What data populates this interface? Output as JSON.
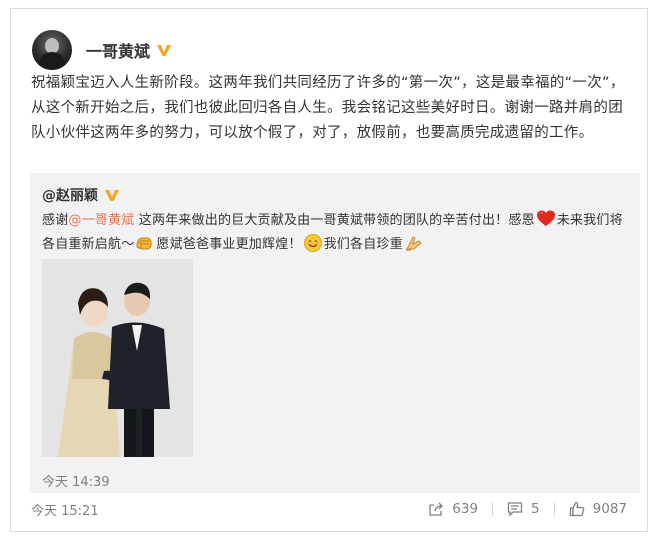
{
  "post": {
    "author": "一哥黄斌",
    "verified_badge_icon": "verified-v-icon",
    "text": "祝福颖宝迈入人生新阶段。这两年我们共同经历了许多的“第一次”，这是最幸福的“一次”，从这个新开始之后，我们也彼此回归各自人生。我会铭记这些美好时日。谢谢一路并肩的团队小伙伴这两年多的努力，可以放个假了，对了，放假前，也要高质完成遗留的工作。",
    "time": "今天 15:21"
  },
  "repost": {
    "author": "@赵丽颖",
    "text_before_mention": "感谢",
    "mention": "@一哥黄斌",
    "text_after_mention": " 这两年来做出的巨大贡献及由一哥黄斌带领的团队的辛苦付出！感恩",
    "text_line2_a": "未来我们将各自重新启航～",
    "text_line2_b": "愿斌爸爸事业更加辉煌！",
    "text_line2_c": "我们各自珍重",
    "emojis": [
      "heart-emoji",
      "fist-emoji",
      "smile-emoji",
      "pray-emoji"
    ],
    "time": "今天 14:39"
  },
  "actions": {
    "share_count": "639",
    "comment_count": "5",
    "like_count": "9087"
  },
  "colors": {
    "mention": "#eb7350",
    "badge": "#f5a623",
    "repost_bg": "#f2f2f5",
    "meta": "#808080"
  }
}
